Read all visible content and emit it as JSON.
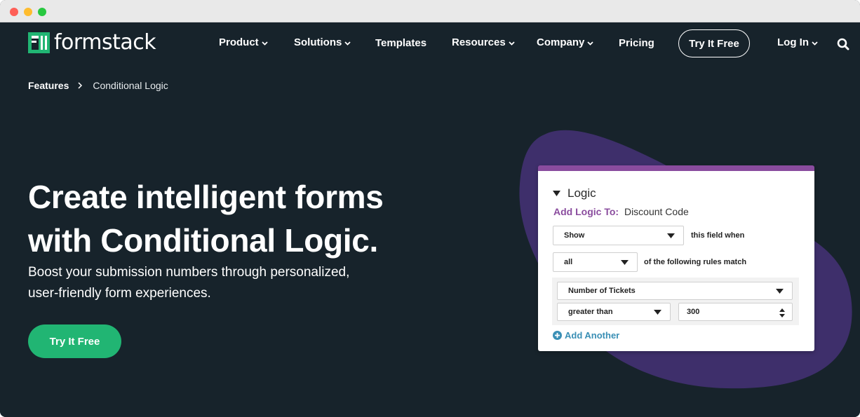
{
  "brand": {
    "name": "formstack",
    "logo_color": "#21b573"
  },
  "nav": {
    "items": [
      {
        "label": "Product",
        "dropdown": true
      },
      {
        "label": "Solutions",
        "dropdown": true
      },
      {
        "label": "Templates",
        "dropdown": false
      },
      {
        "label": "Resources",
        "dropdown": true
      },
      {
        "label": "Company",
        "dropdown": true
      },
      {
        "label": "Pricing",
        "dropdown": false
      }
    ],
    "cta_label": "Try It Free",
    "login_label": "Log In",
    "search_icon": "search-icon"
  },
  "breadcrumb": {
    "parent": "Features",
    "current": "Conditional Logic"
  },
  "hero": {
    "title_line1": "Create intelligent forms",
    "title_line2": "with Conditional Logic.",
    "subtitle_line1": "Boost your submission numbers through personalized,",
    "subtitle_line2": "user-friendly form experiences.",
    "cta_label": "Try It Free"
  },
  "logic_card": {
    "heading": "Logic",
    "add_logic_label": "Add Logic To:",
    "add_logic_value": "Discount Code",
    "action_select": "Show",
    "action_suffix": "this field when",
    "match_select": "all",
    "match_suffix": "of the following rules match",
    "rule": {
      "field": "Number of Tickets",
      "operator": "greater than",
      "value": "300"
    },
    "add_another_label": "Add Another"
  },
  "colors": {
    "background": "#17232b",
    "accent_green": "#21b573",
    "accent_purple": "#8a4c9e",
    "blob_purple": "#3e2f6b",
    "link_blue": "#3a8fb5"
  }
}
